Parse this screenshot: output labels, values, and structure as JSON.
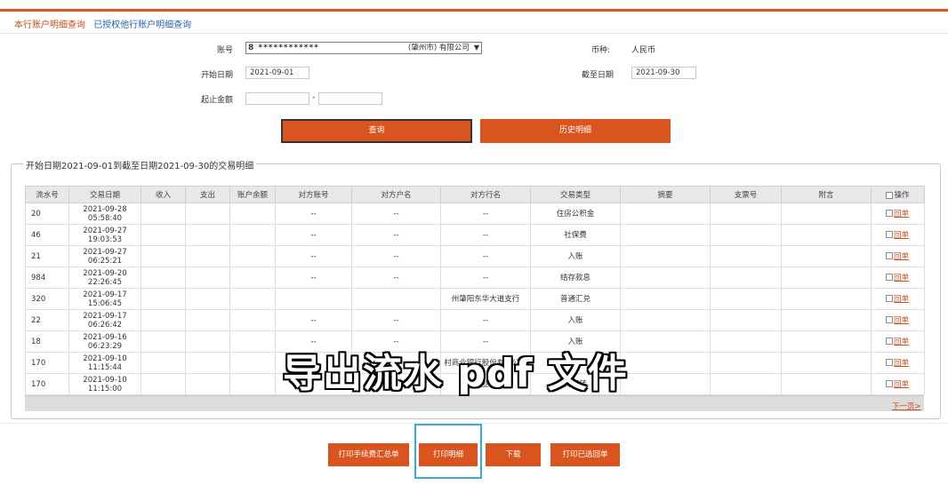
{
  "tabs": {
    "current": "本行账户明细查询",
    "other": "已授权他行账户明细查询"
  },
  "form": {
    "account_label": "账号",
    "account_value": "8 ************",
    "account_bank": "(肇州市) 有限公司",
    "currency_label": "币种:",
    "currency_value": "人民币",
    "start_label": "开始日期",
    "start_value": "2021-09-01",
    "end_label": "截至日期",
    "end_value": "2021-09-30",
    "amount_label": "起止金额",
    "amount_sep": "-",
    "query_btn": "查询",
    "history_btn": "历史明细"
  },
  "section_title": "开始日期2021-09-01到截至日期2021-09-30的交易明细",
  "table": {
    "headers": [
      "流水号",
      "交易日期",
      "收入",
      "支出",
      "账户余额",
      "对方账号",
      "对方户名",
      "对方行名",
      "交易类型",
      "摘要",
      "支票号",
      "附言",
      "操作"
    ],
    "rows": [
      {
        "sn": "20",
        "date": "2021-09-28",
        "time": "05:58:40",
        "acct": "--",
        "name": "--",
        "bank": "--",
        "type": "住房公积金",
        "op": "回单"
      },
      {
        "sn": "46",
        "date": "2021-09-27",
        "time": "19:03:53",
        "acct": "--",
        "name": "--",
        "bank": "--",
        "type": "社保费",
        "op": "回单"
      },
      {
        "sn": "21",
        "date": "2021-09-27",
        "time": "06:25:21",
        "acct": "--",
        "name": "--",
        "bank": "--",
        "type": "入账",
        "op": "回单"
      },
      {
        "sn": "984",
        "date": "2021-09-20",
        "time": "22:26:45",
        "acct": "--",
        "name": "--",
        "bank": "--",
        "type": "结存款息",
        "op": "回单"
      },
      {
        "sn": "320",
        "date": "2021-09-17",
        "time": "15:06:45",
        "acct": "",
        "name": "",
        "bank": "州肇阳东华大道支行",
        "type": "普通汇兑",
        "op": "回单"
      },
      {
        "sn": "22",
        "date": "2021-09-17",
        "time": "06:26:42",
        "acct": "--",
        "name": "--",
        "bank": "--",
        "type": "入账",
        "op": "回单"
      },
      {
        "sn": "18",
        "date": "2021-09-16",
        "time": "06:23:29",
        "acct": "--",
        "name": "--",
        "bank": "--",
        "type": "入账",
        "op": "回单"
      },
      {
        "sn": "170",
        "date": "2021-09-10",
        "time": "11:15:44",
        "acct": "",
        "name": "",
        "bank": "村商业银行股份有限公司",
        "type": "网银",
        "op": "回单"
      },
      {
        "sn": "170",
        "date": "2021-09-10",
        "time": "11:15:00",
        "acct": "",
        "name": "",
        "bank": "村商业公司",
        "type": "网银转",
        "op": "回单"
      }
    ]
  },
  "next_page": "下一页>",
  "buttons": {
    "print_fee": "打印手续费汇总单",
    "print_detail": "打印明细",
    "download": "下载",
    "print_selected": "打印已选回单"
  },
  "caption": "导出流水 pdf 文件",
  "colors": {
    "accent": "#d9541e",
    "link": "#c5501d",
    "highlight": "#3fa7e0"
  }
}
